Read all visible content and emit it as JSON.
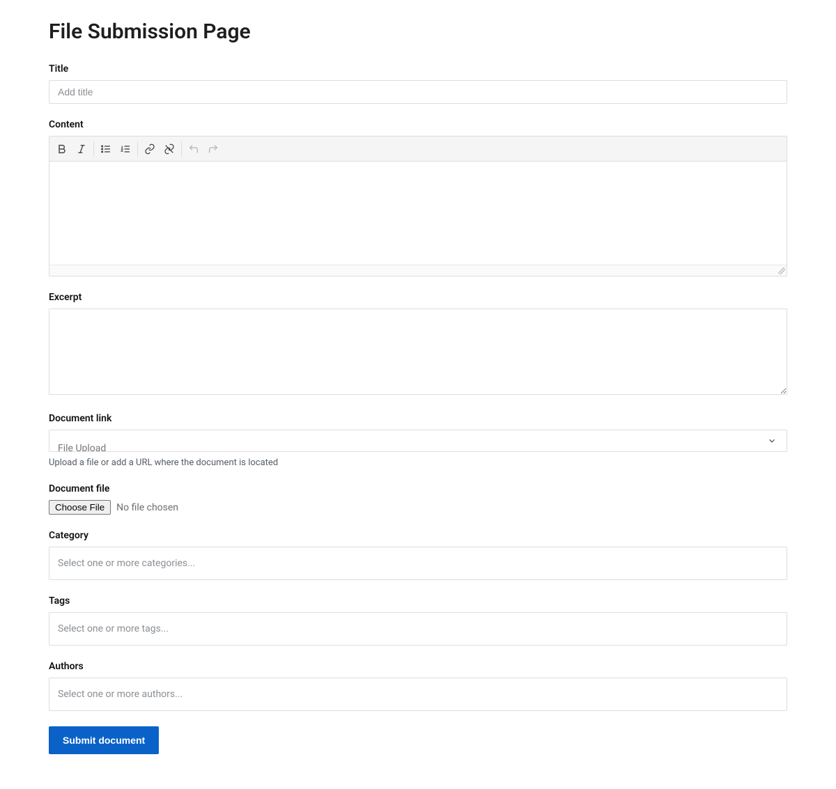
{
  "page": {
    "title": "File Submission Page"
  },
  "title_field": {
    "label": "Title",
    "placeholder": "Add title",
    "value": ""
  },
  "content_field": {
    "label": "Content",
    "value": "",
    "toolbar_icons": [
      "bold",
      "italic",
      "bullet-list",
      "numbered-list",
      "link",
      "unlink",
      "undo",
      "redo"
    ]
  },
  "excerpt_field": {
    "label": "Excerpt",
    "value": ""
  },
  "doclink_field": {
    "label": "Document link",
    "selected": "File Upload",
    "help": "Upload a file or add a URL where the document is located"
  },
  "docfile_field": {
    "label": "Document file",
    "button": "Choose File",
    "status": "No file chosen"
  },
  "category_field": {
    "label": "Category",
    "placeholder": "Select one or more categories..."
  },
  "tags_field": {
    "label": "Tags",
    "placeholder": "Select one or more tags..."
  },
  "authors_field": {
    "label": "Authors",
    "placeholder": "Select one or more authors..."
  },
  "submit": {
    "label": "Submit document"
  }
}
